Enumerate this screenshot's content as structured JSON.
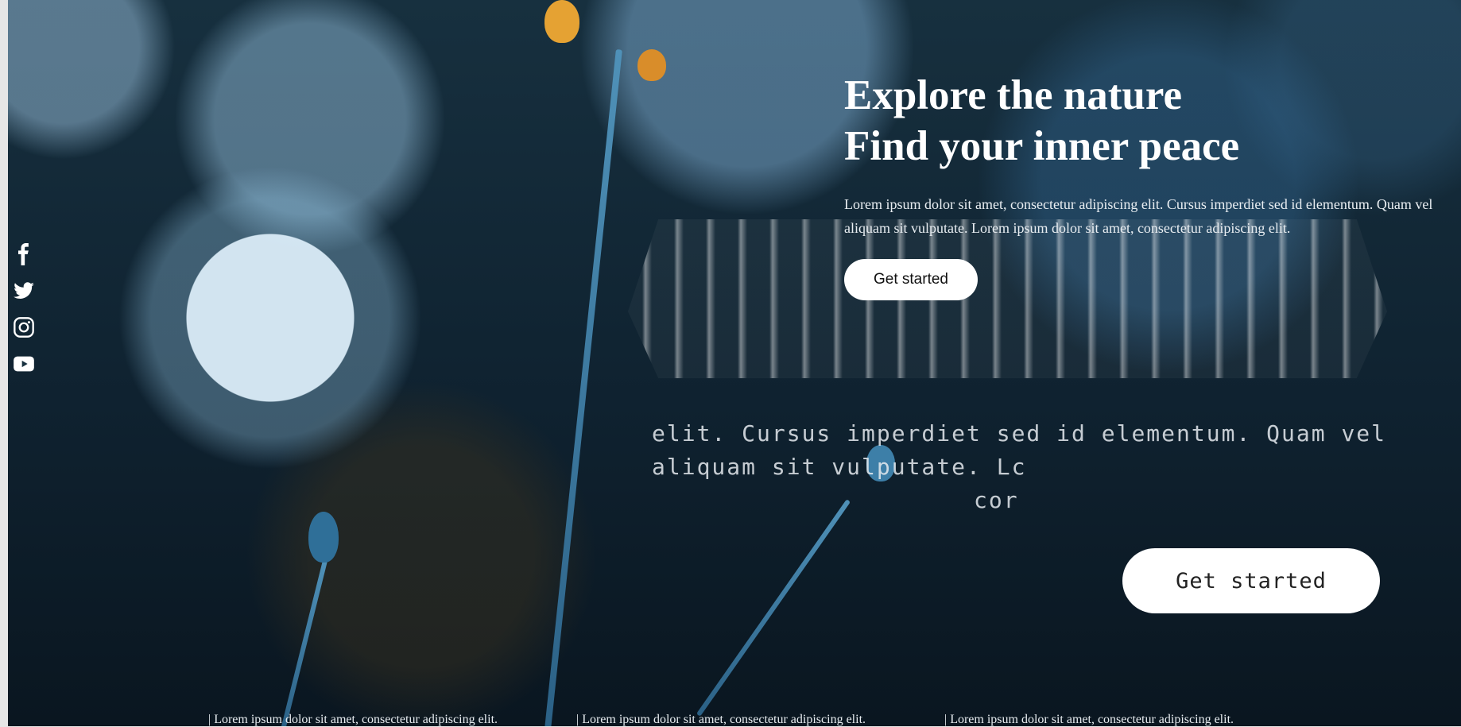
{
  "hero": {
    "headline_line1": "Explore the nature",
    "headline_line2": "Find your inner peace",
    "lead": "Lorem ipsum dolor sit amet, consectetur adipiscing elit. Cursus imperdiet sed id elementum. Quam vel aliquam sit vulputate. Lorem ipsum dolor sit amet, consectetur adipiscing elit.",
    "cta_label": "Get started"
  },
  "echo": {
    "line1": "elit. Cursus imperdiet sed id elementum. Quam vel",
    "line2": "aliquam sit vulputate. Lc",
    "line3": "cor",
    "cta_label": "Get started"
  },
  "social": [
    "facebook-icon",
    "twitter-icon",
    "instagram-icon",
    "youtube-icon"
  ],
  "ticker": {
    "item1": "| Lorem ipsum dolor sit amet, consectetur adipiscing elit.",
    "item2": "| Lorem ipsum dolor sit amet, consectetur adipiscing elit.",
    "item3": "| Lorem ipsum dolor sit amet, consectetur adipiscing elit."
  },
  "colors": {
    "background": "#0f2230",
    "accent_blue": "#4f91b8",
    "flower_orange": "#e5a233",
    "text": "#ffffff"
  }
}
